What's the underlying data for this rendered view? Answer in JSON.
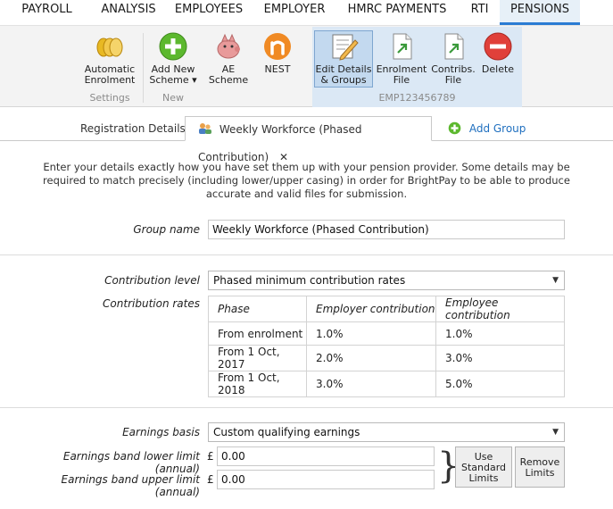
{
  "topnav": {
    "tabs": [
      {
        "label": "PAYROLL"
      },
      {
        "label": "ANALYSIS"
      },
      {
        "label": "EMPLOYEES"
      },
      {
        "label": "EMPLOYER"
      },
      {
        "label": "HMRC PAYMENTS"
      },
      {
        "label": "RTI"
      },
      {
        "label": "PENSIONS",
        "active": true
      }
    ]
  },
  "ribbon": {
    "settings": {
      "auto_enrolment_line1": "Automatic",
      "auto_enrolment_line2": "Enrolment",
      "group_label": "Settings"
    },
    "new": {
      "add_scheme_line1": "Add New",
      "add_scheme_line2": "Scheme ▾",
      "ae_scheme_line1": "AE",
      "ae_scheme_line2": "Scheme",
      "nest": "NEST",
      "group_label": "New"
    },
    "context": {
      "edit_line1": "Edit Details",
      "edit_line2": "& Groups",
      "enrolment_line1": "Enrolment",
      "enrolment_line2": "File",
      "contribs_line1": "Contribs.",
      "contribs_line2": "File",
      "delete": "Delete",
      "group_label": "EMP123456789"
    }
  },
  "tabs": {
    "registration": "Registration Details",
    "group_tab": "Weekly Workforce (Phased Contribution)",
    "close_glyph": "✕",
    "add_group": "Add Group"
  },
  "intro_text": "Enter your details exactly how you have set them up with your pension provider. Some details may be required to match precisely (including lower/upper casing) in order for BrightPay to be able to produce accurate and valid files for submission.",
  "form": {
    "group_name_label": "Group name",
    "group_name_value": "Weekly Workforce (Phased Contribution)",
    "contribution_level_label": "Contribution level",
    "contribution_level_value": "Phased minimum contribution rates",
    "contribution_rates_label": "Contribution rates",
    "rates_table": {
      "headers": [
        "Phase",
        "Employer contribution",
        "Employee contribution"
      ],
      "rows": [
        [
          "From enrolment",
          "1.0%",
          "1.0%"
        ],
        [
          "From 1 Oct, 2017",
          "2.0%",
          "3.0%"
        ],
        [
          "From 1 Oct, 2018",
          "3.0%",
          "5.0%"
        ]
      ]
    },
    "earnings_basis_label": "Earnings basis",
    "earnings_basis_value": "Custom qualifying earnings",
    "lower_limit_label": "Earnings band lower limit (annual)",
    "upper_limit_label": "Earnings band upper limit (annual)",
    "currency_symbol": "£",
    "lower_limit_value": "0.00",
    "upper_limit_value": "0.00",
    "brace": "}",
    "use_standard_line1": "Use",
    "use_standard_line2": "Standard",
    "use_standard_line3": "Limits",
    "remove_limits_line1": "Remove",
    "remove_limits_line2": "Limits"
  },
  "colors": {
    "accent": "#2b7cd3",
    "active_tab_bg": "#e7f0f8",
    "context_group_bg": "#dbe8f5",
    "link": "#1f6fbf"
  }
}
